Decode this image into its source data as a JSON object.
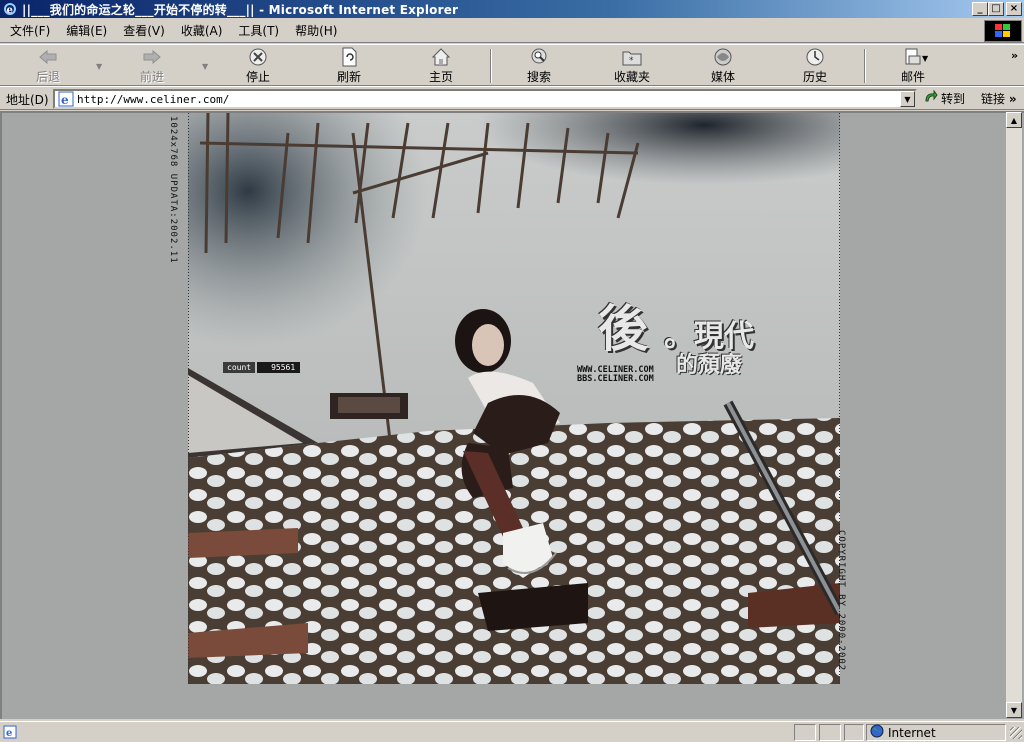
{
  "window": {
    "title": "||___我们的命运之轮___开始不停的转___|| - Microsoft Internet Explorer",
    "buttons": {
      "minimize": "_",
      "maximize": "□",
      "close": "×"
    }
  },
  "menu": {
    "items": [
      {
        "label": "文件(F)"
      },
      {
        "label": "编辑(E)"
      },
      {
        "label": "查看(V)"
      },
      {
        "label": "收藏(A)"
      },
      {
        "label": "工具(T)"
      },
      {
        "label": "帮助(H)"
      }
    ]
  },
  "toolbar": {
    "back": "后退",
    "forward": "前进",
    "stop": "停止",
    "refresh": "刷新",
    "home": "主页",
    "search": "搜索",
    "favorites": "收藏夹",
    "media": "媒体",
    "history": "历史",
    "mail": "邮件",
    "more": "»"
  },
  "address": {
    "label": "地址(D)",
    "url": "http://www.celiner.com/",
    "go": "转到",
    "links": "链接",
    "more": "»"
  },
  "page": {
    "left_vertical": "1024x768 UPDATA:2002.11",
    "right_vertical": "COPYRIGHT BY 2000-2002",
    "counter_key": "count",
    "counter_value": "95561",
    "brand_char": "後",
    "brand_rest": "。現代",
    "brand_sub": "的頹廢",
    "brand_url1": "WWW.CELINER.COM",
    "brand_url2": "BBS.CELINER.COM"
  },
  "statusbar": {
    "zone": "Internet"
  },
  "colors": {
    "titlebar_start": "#0a246a",
    "titlebar_end": "#a6caf0",
    "chrome": "#d4d0c8",
    "page_background": "#a4a7a6"
  }
}
